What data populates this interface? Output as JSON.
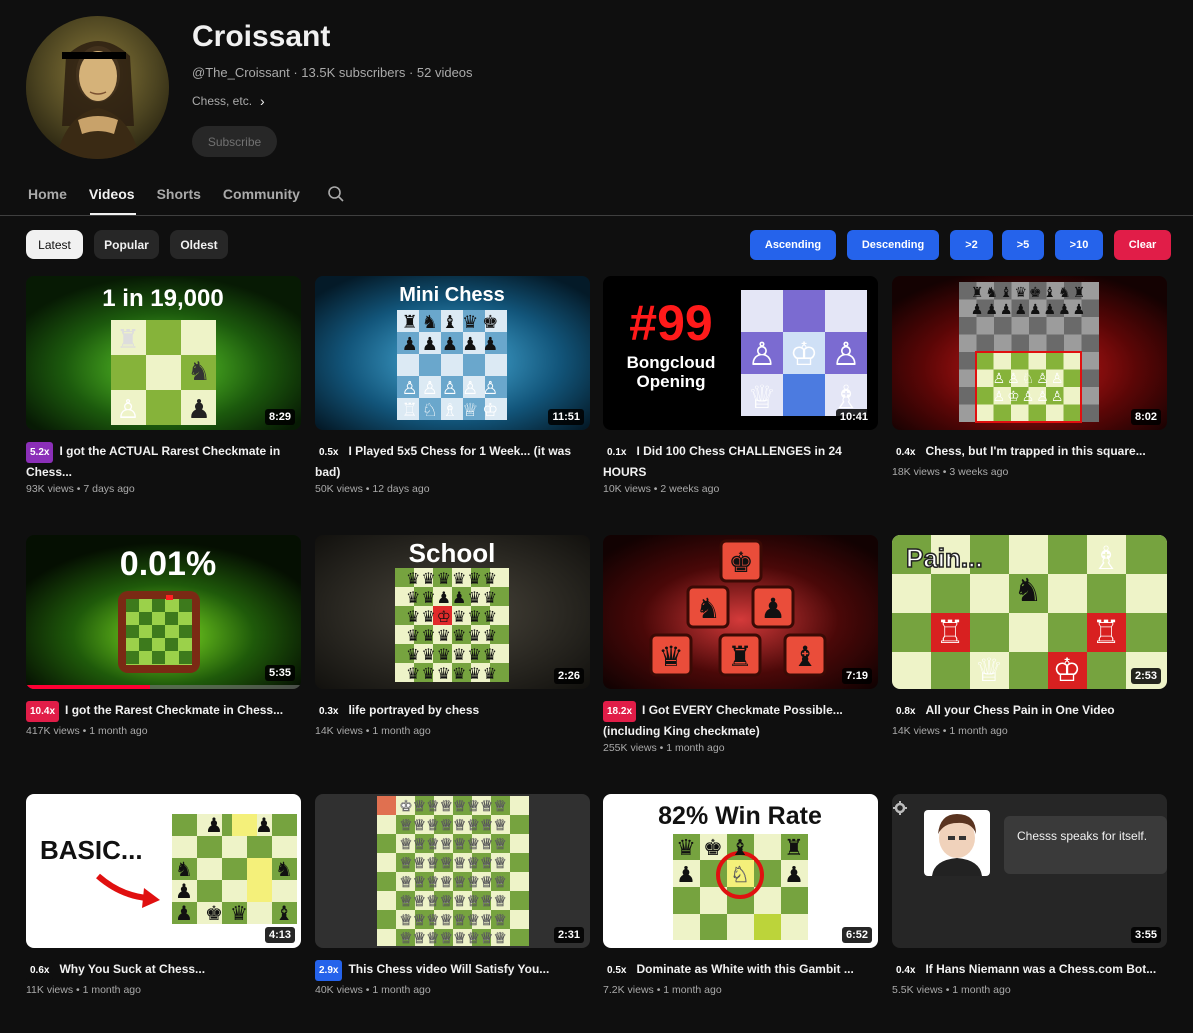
{
  "channel": {
    "name": "Croissant",
    "meta": "@The_Croissant · 13.5K subscribers · 52 videos",
    "description": "Chess, etc.",
    "subscribe_label": "Subscribe"
  },
  "tabs": [
    "Home",
    "Videos",
    "Shorts",
    "Community"
  ],
  "chips": [
    "Latest",
    "Popular",
    "Oldest"
  ],
  "filters": [
    "Ascending",
    "Descending",
    ">2",
    ">5",
    ">10",
    "Clear"
  ],
  "videos": [
    {
      "speed": "5.2x",
      "speed_color": "#8b2fb8",
      "title": "I got the ACTUAL Rarest Checkmate in Chess...",
      "meta": "93K views • 7 days ago",
      "duration": "8:29",
      "thumb_text": "1 in 19,000"
    },
    {
      "speed": "0.5x",
      "speed_color": "#0f0f0f",
      "title": "I Played 5x5 Chess for 1 Week... (it was bad)",
      "meta": "50K views • 12 days ago",
      "duration": "11:51",
      "thumb_text": "Mini Chess"
    },
    {
      "speed": "0.1x",
      "speed_color": "#0f0f0f",
      "title": "I Did 100 Chess CHALLENGES in 24 HOURS",
      "meta": "10K views • 2 weeks ago",
      "duration": "10:41",
      "thumb_text": "#99",
      "thumb_text2": "Bongcloud Opening"
    },
    {
      "speed": "0.4x",
      "speed_color": "#0f0f0f",
      "title": "Chess, but I'm trapped in this square...",
      "meta": "18K views • 3 weeks ago",
      "duration": "8:02",
      "thumb_text": ""
    },
    {
      "speed": "10.4x",
      "speed_color": "#e11d48",
      "title": "I got the Rarest Checkmate in Chess...",
      "meta": "417K views • 1 month ago",
      "duration": "5:35",
      "thumb_text": "0.01%",
      "progress": 0.45
    },
    {
      "speed": "0.3x",
      "speed_color": "#0f0f0f",
      "title": "life portrayed by chess",
      "meta": "14K views • 1 month ago",
      "duration": "2:26",
      "thumb_text": "School"
    },
    {
      "speed": "18.2x",
      "speed_color": "#e11d48",
      "title": "I Got EVERY Checkmate Possible... (including King checkmate)",
      "meta": "255K views • 1 month ago",
      "duration": "7:19",
      "thumb_text": ""
    },
    {
      "speed": "0.8x",
      "speed_color": "#0f0f0f",
      "title": "All your Chess Pain in One Video",
      "meta": "14K views • 1 month ago",
      "duration": "2:53",
      "thumb_text": "Pain..."
    },
    {
      "speed": "0.6x",
      "speed_color": "#0f0f0f",
      "title": "Why You Suck at Chess...",
      "meta": "11K views • 1 month ago",
      "duration": "4:13",
      "thumb_text": "BASIC..."
    },
    {
      "speed": "2.9x",
      "speed_color": "#2563eb",
      "title": "This Chess video Will Satisfy You...",
      "meta": "40K views • 1 month ago",
      "duration": "2:31",
      "thumb_text": ""
    },
    {
      "speed": "0.5x",
      "speed_color": "#0f0f0f",
      "title": "Dominate as White with this Gambit ...",
      "meta": "7.2K views • 1 month ago",
      "duration": "6:52",
      "thumb_text": "82% Win Rate"
    },
    {
      "speed": "0.4x",
      "speed_color": "#0f0f0f",
      "title": "If Hans Niemann was a Chess.com Bot...",
      "meta": "5.5K views • 1 month ago",
      "duration": "3:55",
      "thumb_text": "Chesss speaks for itself."
    }
  ]
}
